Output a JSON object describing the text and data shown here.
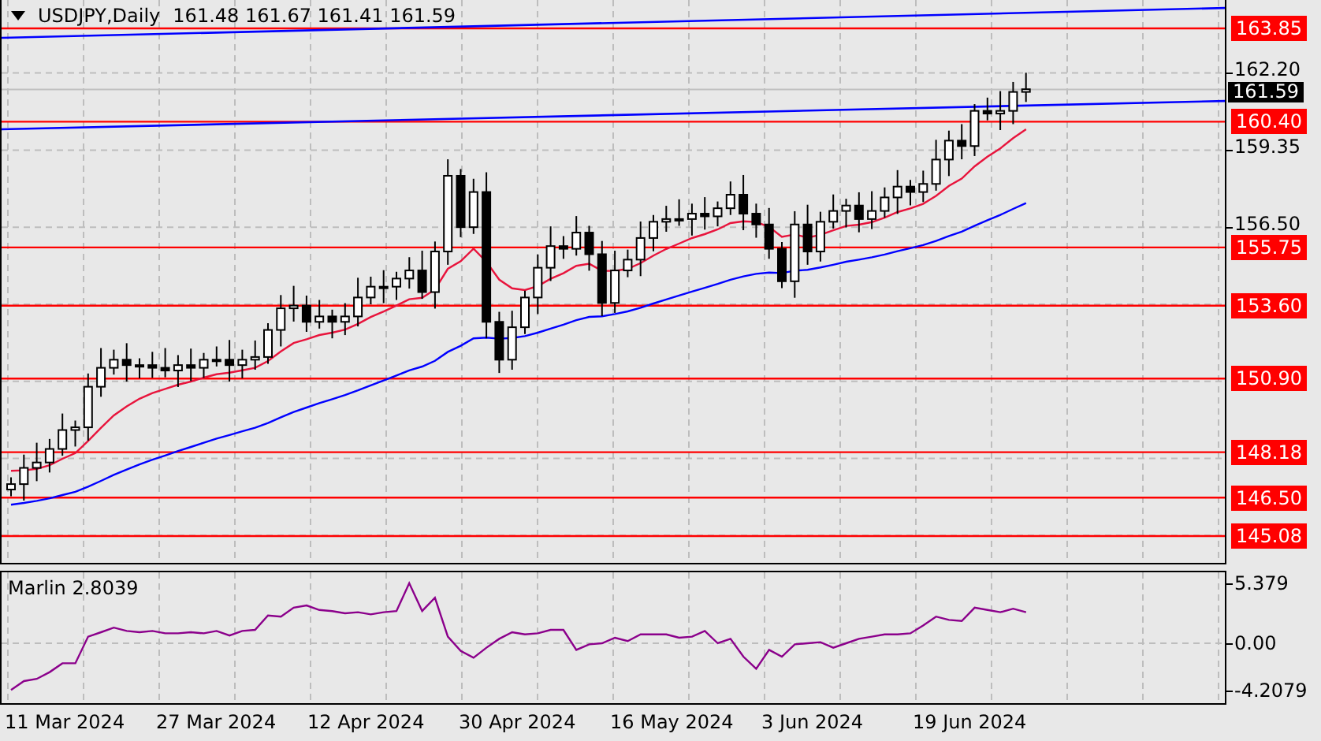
{
  "header": {
    "symbol": "USDJPY,Daily",
    "ohlc": "161.48 161.67 161.41 161.59"
  },
  "price_axis": {
    "ticks": [
      "162.20",
      "159.35",
      "156.50"
    ],
    "levels": [
      {
        "label": "163.85"
      },
      {
        "label": "160.40"
      },
      {
        "label": "155.75"
      },
      {
        "label": "153.60"
      },
      {
        "label": "150.90"
      },
      {
        "label": "148.18"
      },
      {
        "label": "146.50"
      },
      {
        "label": "145.08"
      }
    ],
    "current_price": "161.59"
  },
  "indicator": {
    "name": "Marlin 2.8039",
    "ticks": [
      "5.379",
      "0.00",
      "-4.2079"
    ]
  },
  "date_axis": {
    "labels": [
      "11 Mar 2024",
      "27 Mar 2024",
      "12 Apr 2024",
      "30 Apr 2024",
      "16 May 2024",
      "3 Jun 2024",
      "19 Jun 2024"
    ]
  }
}
